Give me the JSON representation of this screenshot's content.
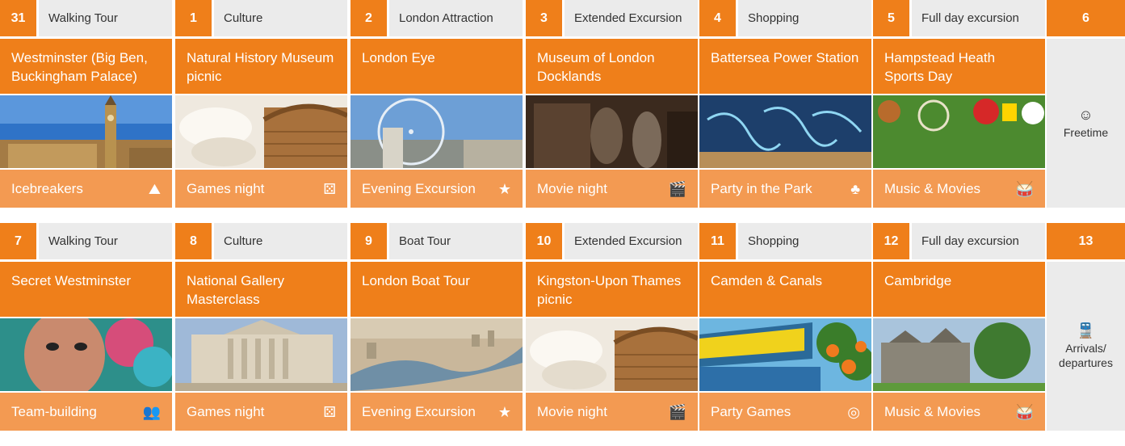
{
  "weeks": [
    {
      "days": [
        {
          "num": "31",
          "category": "Walking Tour",
          "title": "Westminster (Big Ben, Buckingham Palace)",
          "photo": "big-ben-westminster",
          "evening": "Icebreakers",
          "evening_icon": "mountain-icon",
          "evening_glyph": "⛰"
        },
        {
          "num": "1",
          "category": "Culture",
          "title": "Natural History Museum picnic",
          "photo": "picnic-basket",
          "evening": "Games night",
          "evening_icon": "dice-icon",
          "evening_glyph": "⚄"
        },
        {
          "num": "2",
          "category": "London Attraction",
          "title": "London Eye",
          "photo": "london-eye",
          "evening": "Evening Excursion",
          "evening_icon": "night-sky-icon",
          "evening_glyph": "★"
        },
        {
          "num": "3",
          "category": "Extended Excursion",
          "title": "Museum of London Docklands",
          "photo": "museum-interior",
          "evening": "Movie night",
          "evening_icon": "clapperboard-icon",
          "evening_glyph": "🎬"
        },
        {
          "num": "4",
          "category": "Shopping",
          "title": "Battersea Power Station",
          "photo": "light-installation",
          "evening": "Party in the Park",
          "evening_icon": "tree-icon",
          "evening_glyph": "♣"
        },
        {
          "num": "5",
          "category": "Full day excursion",
          "title": "Hampstead Heath Sports Day",
          "photo": "sports-balls",
          "evening": "Music & Movies",
          "evening_icon": "drum-icon",
          "evening_glyph": "🥁"
        }
      ],
      "side": {
        "num": "6",
        "icon": "grinning-face-icon",
        "glyph": "☺",
        "label": "Freetime"
      }
    },
    {
      "days": [
        {
          "num": "7",
          "category": "Walking Tour",
          "title": "Secret Westminster",
          "photo": "street-art-face",
          "evening": "Team-building",
          "evening_icon": "team-icon",
          "evening_glyph": "👥"
        },
        {
          "num": "8",
          "category": "Culture",
          "title": "National Gallery Masterclass",
          "photo": "national-gallery",
          "evening": "Games night",
          "evening_icon": "dice-icon",
          "evening_glyph": "⚄"
        },
        {
          "num": "9",
          "category": "Boat Tour",
          "title": "London Boat Tour",
          "photo": "thames-aerial",
          "evening": "Evening Excursion",
          "evening_icon": "night-sky-icon",
          "evening_glyph": "★"
        },
        {
          "num": "10",
          "category": "Extended Excursion",
          "title": "Kingston-Upon Thames picnic",
          "photo": "picnic-basket",
          "evening": "Movie night",
          "evening_icon": "clapperboard-icon",
          "evening_glyph": "🎬"
        },
        {
          "num": "11",
          "category": "Shopping",
          "title": "Camden & Canals",
          "photo": "camden-market",
          "evening": "Party Games",
          "evening_icon": "target-icon",
          "evening_glyph": "◎"
        },
        {
          "num": "12",
          "category": "Full day excursion",
          "title": "Cambridge",
          "photo": "cambridge-college",
          "evening": "Music & Movies",
          "evening_icon": "drum-icon",
          "evening_glyph": "🥁"
        }
      ],
      "side": {
        "num": "13",
        "icon": "train-icon",
        "glyph": "🚆",
        "label": "Arrivals/ departures"
      }
    }
  ],
  "colors": {
    "orange": "#ef7f1a",
    "light_orange": "#f39a52",
    "grey": "#ebebeb"
  }
}
